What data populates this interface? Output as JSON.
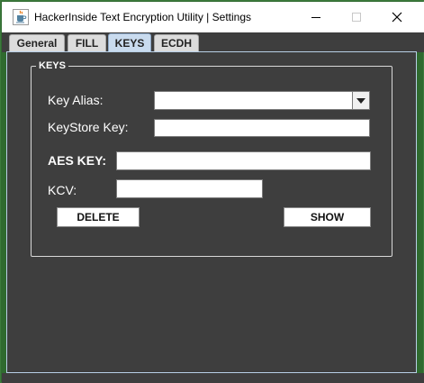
{
  "window": {
    "title": "HackerInside Text Encryption Utility | Settings",
    "app_icon": "java-cup-icon"
  },
  "titlebar_buttons": {
    "minimize_icon": "minimize-icon",
    "maximize_icon": "maximize-icon",
    "close_icon": "close-icon"
  },
  "tabs": [
    {
      "label": "General",
      "active": false
    },
    {
      "label": "FILL",
      "active": false
    },
    {
      "label": "KEYS",
      "active": true
    },
    {
      "label": "ECDH",
      "active": false
    }
  ],
  "keys_panel": {
    "legend": "KEYS",
    "key_alias_label": "Key Alias:",
    "key_alias_value": "",
    "keystore_key_label": "KeyStore Key:",
    "keystore_key_value": "",
    "aes_key_label": "AES KEY:",
    "aes_key_value": "",
    "kcv_label": "KCV:",
    "kcv_value": "",
    "delete_label": "DELETE",
    "show_label": "SHOW"
  },
  "colors": {
    "panel_bg": "#3e3e3e",
    "active_tab": "#c9dbee",
    "window_border": "#2f6a2f"
  }
}
